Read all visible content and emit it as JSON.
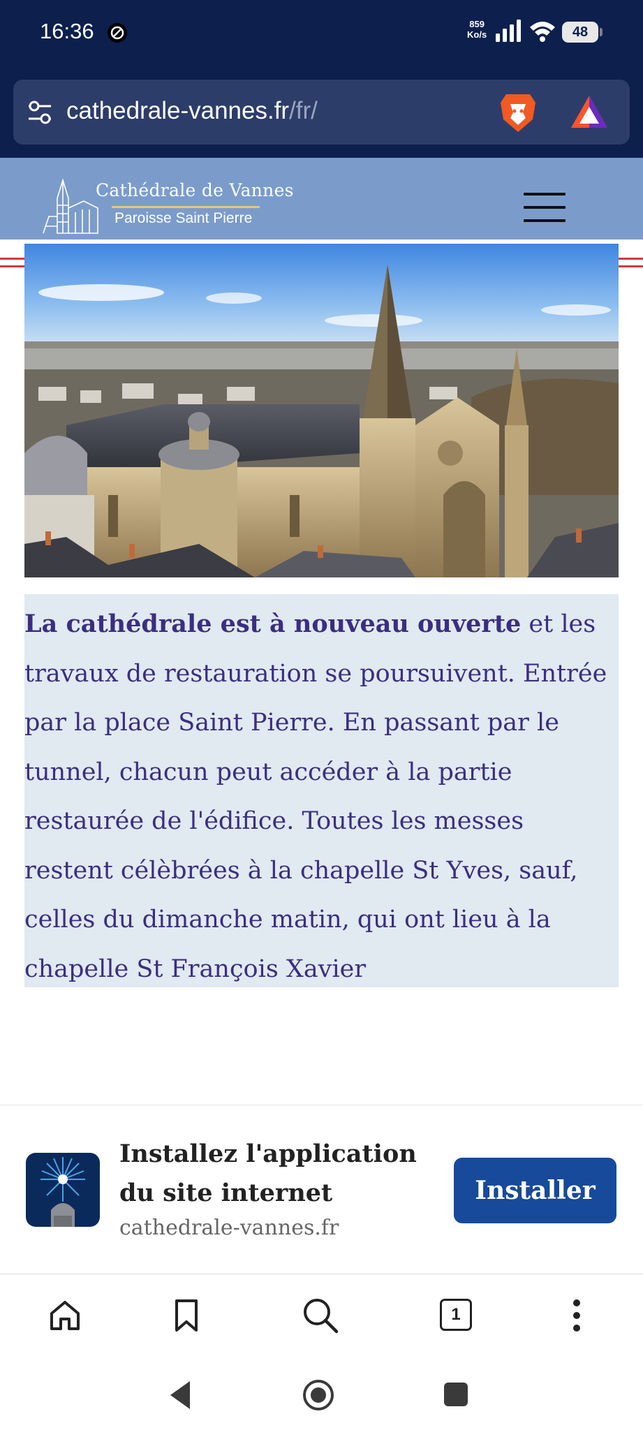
{
  "status_bar": {
    "time": "16:36",
    "net_speed_value": "859",
    "net_speed_unit": "Ko/s",
    "battery": "48"
  },
  "browser": {
    "url_domain": "cathedrale-vannes.fr",
    "url_path": "/fr/"
  },
  "site": {
    "title": "Cathédrale de Vannes",
    "subtitle": "Paroisse Saint Pierre"
  },
  "notice": {
    "bold": "La cathédrale est à nouveau ouverte",
    "body": " et les travaux de restauration se poursuivent. Entrée par la place Saint Pierre. En passant par le tunnel, chacun peut accéder à la partie restaurée de l'édifice. Toutes les messes restent célèbrées à la chapelle St Yves, sauf, celles du dimanche matin, qui ont lieu à la chapelle St François Xavier"
  },
  "install_banner": {
    "title": "Installez l'application du site internet",
    "domain": "cathedrale-vannes.fr",
    "button": "Installer"
  },
  "toolbar": {
    "tab_count": "1",
    "icons": [
      "home-icon",
      "bookmark-icon",
      "search-icon",
      "tabs-icon",
      "more-icon"
    ]
  },
  "navbar": {
    "icons": [
      "back-icon",
      "home-icon",
      "recents-icon"
    ]
  },
  "colors": {
    "top_bar": "#0d1f4d",
    "url_bar": "#2d3d6a",
    "site_header": "#7b9ccb",
    "notice_background": "#e1e9f1",
    "notice_text": "#3a2e80",
    "install_button": "#174a9a"
  }
}
